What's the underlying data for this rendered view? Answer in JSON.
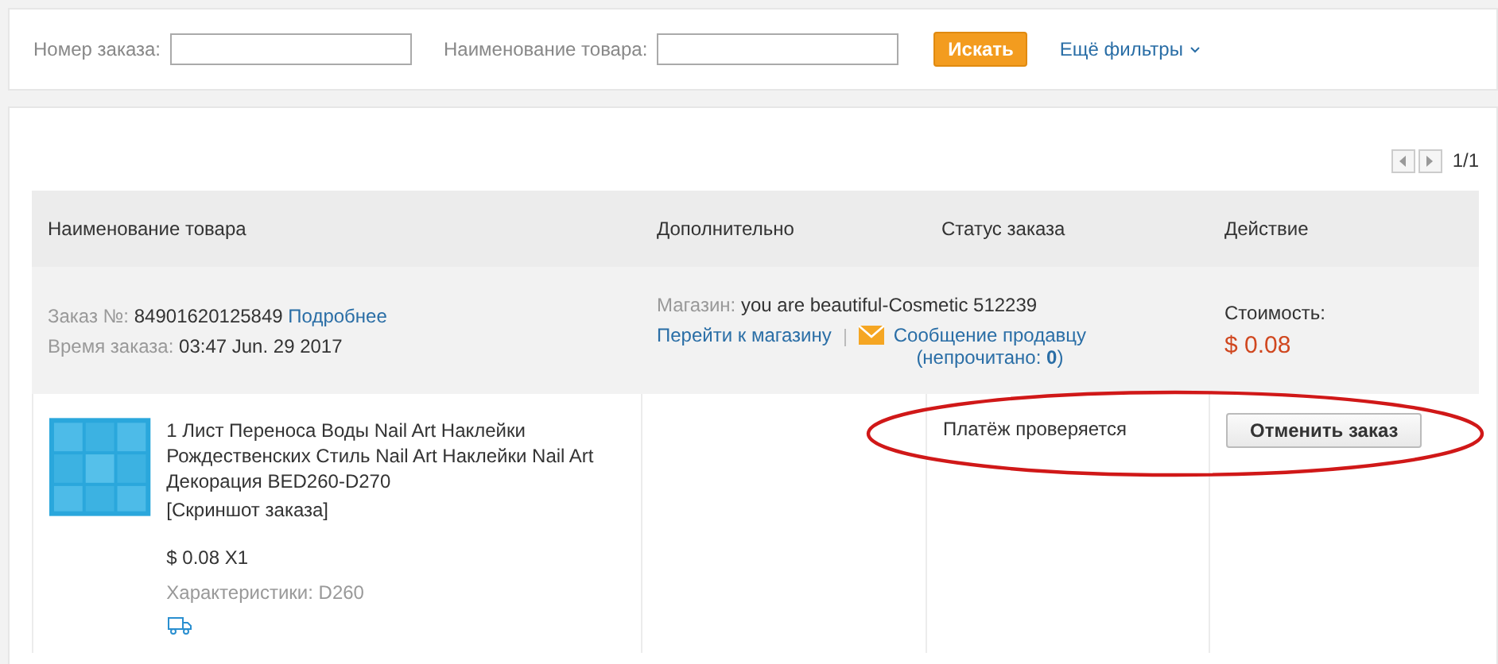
{
  "filters": {
    "order_number": {
      "label": "Номер заказа:"
    },
    "product_name": {
      "label": "Наименование товара:"
    },
    "search_button": "Искать",
    "more_filters": "Ещё фильтры"
  },
  "pagination": {
    "text": "1/1"
  },
  "table": {
    "columns": [
      "Наименование товара",
      "Дополнительно",
      "Статус заказа",
      "Действие"
    ],
    "order": {
      "number_label": "Заказ №:",
      "number": "84901620125849",
      "details_link": "Подробнее",
      "time_label": "Время заказа:",
      "time": "03:47 Jun. 29 2017",
      "shop_label": "Магазин:",
      "shop": "you are beautiful-Cosmetic 512239",
      "shop_link": "Перейти к магазину",
      "message_link": "Сообщение продавцу",
      "unread": "(непрочитано: **0**)",
      "cost_label": "Стоимость:",
      "cost": "$ 0.08"
    },
    "item": {
      "kind": "picture",
      "title": "1 Лист Переноса Воды Nail Art Наклейки Рождественских Стиль Nail Art Наклейки Nail Art Декорация BED260-D270",
      "screenshot_link": "[Скриншот заказа]",
      "price": "$ 0.08 X1",
      "specs": "Характеристики: D260",
      "status": "Платёж проверяется",
      "cancel_button": "Отменить заказ"
    }
  }
}
